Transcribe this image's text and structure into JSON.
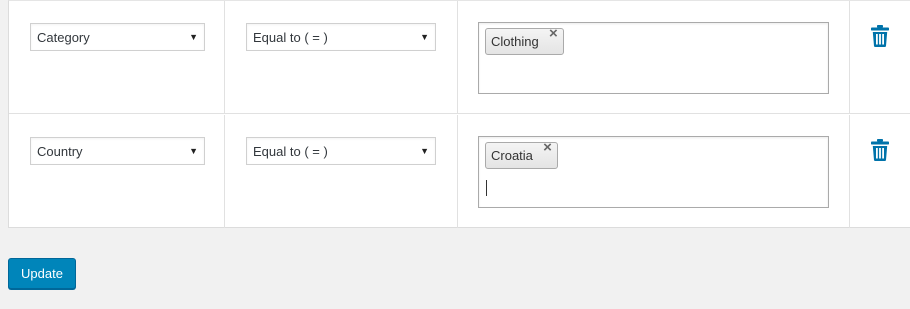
{
  "rules": [
    {
      "parameter": "Category",
      "operator": "Equal to ( = )",
      "values": [
        {
          "label": "Clothing",
          "remove": "×"
        }
      ],
      "show_caret": false,
      "delete_icon": "trash-icon"
    },
    {
      "parameter": "Country",
      "operator": "Equal to ( = )",
      "values": [
        {
          "label": "Croatia",
          "remove": "×"
        }
      ],
      "show_caret": true,
      "delete_icon": "trash-icon"
    }
  ],
  "select_arrow": "▼",
  "actions": {
    "update_label": "Update"
  },
  "colors": {
    "primary_button": "#0085ba",
    "trash_icon": "#0073aa",
    "page_background": "#f1f1f1"
  }
}
